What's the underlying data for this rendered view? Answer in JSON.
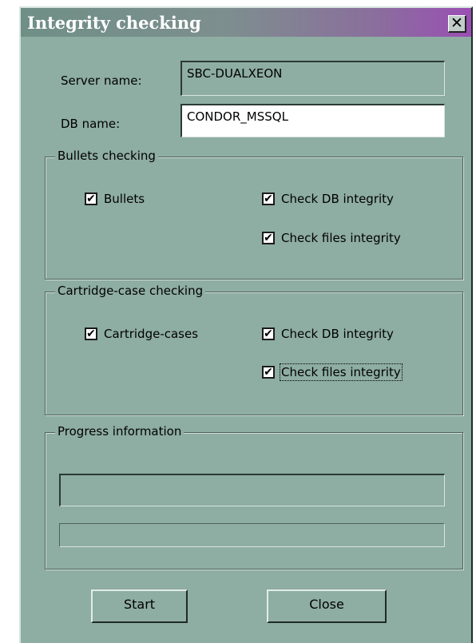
{
  "dialog": {
    "title": "Integrity checking",
    "close_glyph": "✕"
  },
  "server": {
    "label": "Server name:",
    "value": "SBC-DUALXEON"
  },
  "db": {
    "label": "DB name:",
    "value": "CONDOR_MSSQL"
  },
  "bullets": {
    "group_title": "Bullets checking",
    "main": {
      "label": "Bullets",
      "checked": true
    },
    "db_integrity": {
      "label": "Check DB integrity",
      "checked": true
    },
    "files_integrity": {
      "label": "Check files integrity",
      "checked": true
    }
  },
  "cartridges": {
    "group_title": "Cartridge-case checking",
    "main": {
      "label": "Cartridge-cases",
      "checked": true
    },
    "db_integrity": {
      "label": "Check DB integrity",
      "checked": true
    },
    "files_integrity": {
      "label": "Check files integrity",
      "checked": true
    }
  },
  "progress": {
    "group_title": "Progress information",
    "status_text": "",
    "overall_percent": 0
  },
  "buttons": {
    "start": "Start",
    "close": "Close"
  },
  "colors": {
    "dialog_bg": "#8eada3",
    "title_gradient_end": "#9a4fb4"
  },
  "icons": {
    "check": "✔"
  }
}
